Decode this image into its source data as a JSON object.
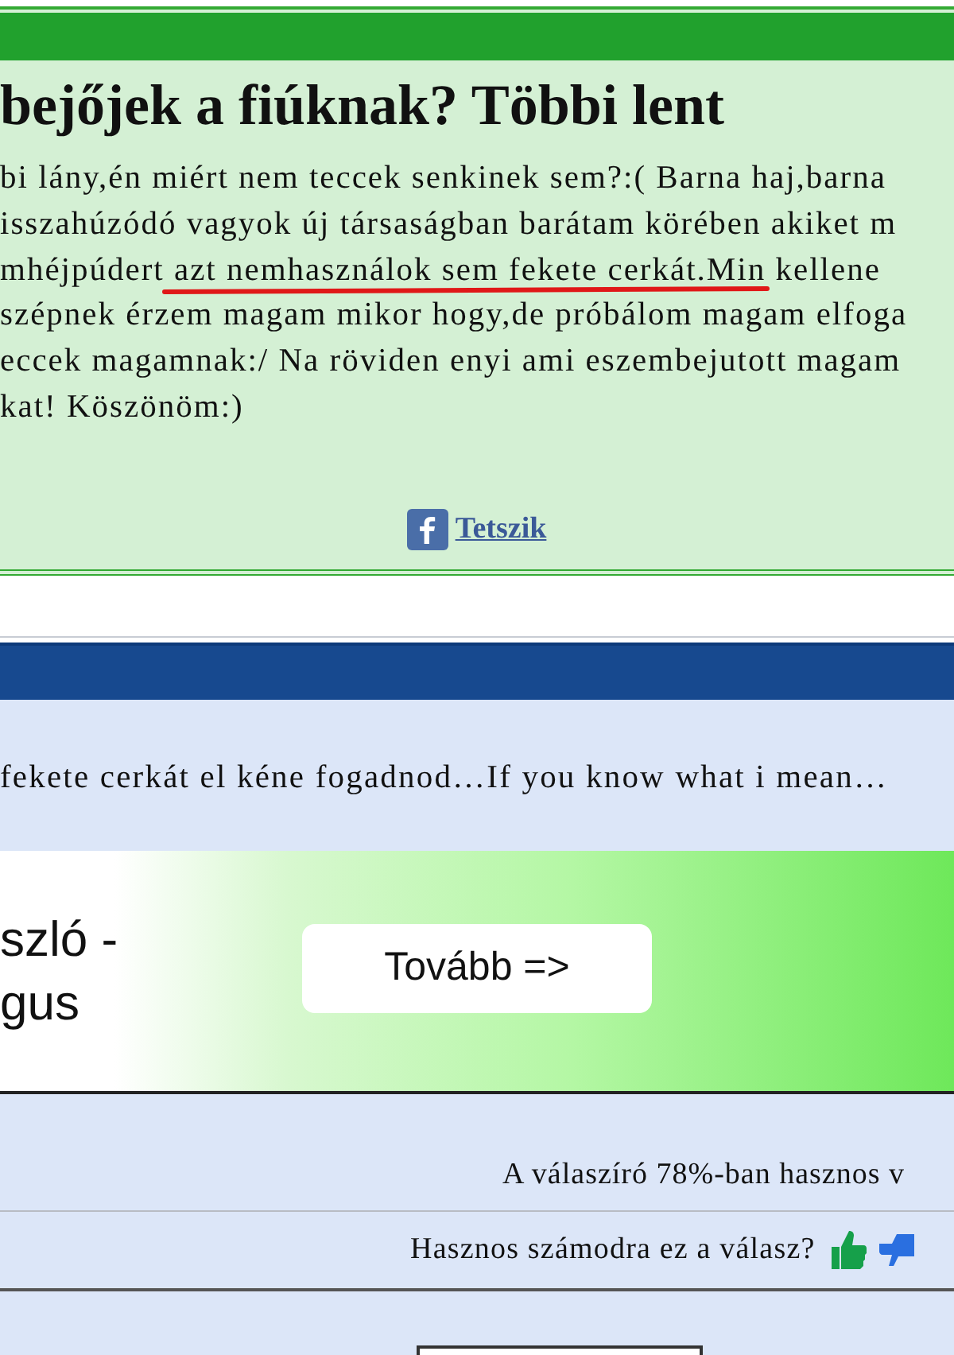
{
  "question": {
    "title": "bejőjek a fiúknak? Többi lent",
    "lines": [
      {
        "text": "bi lány,én miért nem teccek senkinek sem?:( Barna haj,barna",
        "marked": false
      },
      {
        "text": "isszahúzódó vagyok új társaságban barátam körében akiket m",
        "marked": false
      },
      {
        "text": "mhéjpúdert azt nemhasználok sem fekete cerkát.Min kellene",
        "marked": true
      },
      {
        "text": "szépnek érzem magam mikor hogy,de próbálom magam elfoga",
        "marked": false
      },
      {
        "text": "eccek magamnak:/ Na röviden enyi ami eszembejutott magam",
        "marked": false
      },
      {
        "text": "kat! Köszönöm:)",
        "marked": false
      }
    ],
    "like": {
      "label": "Tetszik"
    }
  },
  "answer": {
    "text": "fekete cerkát el kéne fogadnod…If you know what i mean…"
  },
  "ad": {
    "lines": [
      "szló -",
      "gus"
    ],
    "button": "Tovább =>"
  },
  "rating": {
    "text": "A válaszíró 78%-ban hasznos v"
  },
  "feedback": {
    "question": "Hasznos számodra ez a válasz?"
  }
}
